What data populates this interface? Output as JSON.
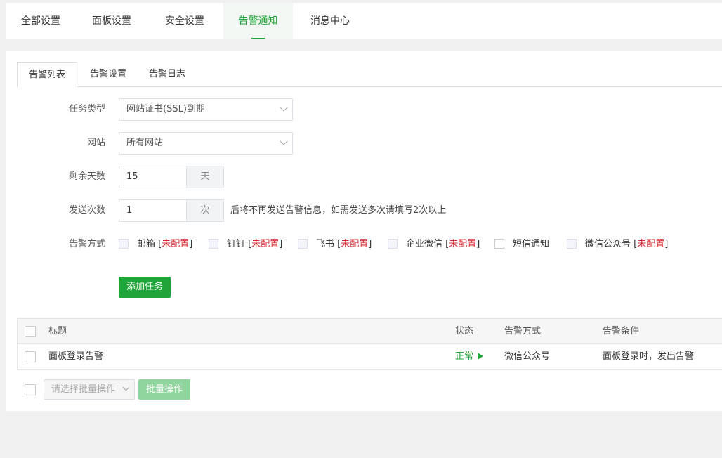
{
  "topnav": {
    "tabs": [
      {
        "label": "全部设置"
      },
      {
        "label": "面板设置"
      },
      {
        "label": "安全设置"
      },
      {
        "label": "告警通知"
      },
      {
        "label": "消息中心"
      }
    ],
    "active": "告警通知"
  },
  "subtabs": {
    "items": [
      {
        "label": "告警列表"
      },
      {
        "label": "告警设置"
      },
      {
        "label": "告警日志"
      }
    ],
    "active": "告警列表"
  },
  "form": {
    "task_type": {
      "label": "任务类型",
      "value": "网站证书(SSL)到期"
    },
    "site": {
      "label": "网站",
      "value": "所有网站"
    },
    "days": {
      "label": "剩余天数",
      "value": "15",
      "unit": "天"
    },
    "send_count": {
      "label": "发送次数",
      "value": "1",
      "unit": "次",
      "hint": "后将不再发送告警信息，如需发送多次请填写2次以上"
    },
    "methods": {
      "label": "告警方式",
      "items": [
        {
          "name": "邮箱",
          "status": "未配置"
        },
        {
          "name": "钉钉",
          "status": "未配置"
        },
        {
          "name": "飞书",
          "status": "未配置"
        },
        {
          "name": "企业微信",
          "status": "未配置"
        },
        {
          "name": "短信通知",
          "status": ""
        },
        {
          "name": "微信公众号",
          "status": "未配置"
        }
      ]
    },
    "add_button": "添加任务"
  },
  "table": {
    "headers": [
      "标题",
      "状态",
      "告警方式",
      "告警条件"
    ],
    "rows": [
      {
        "title": "面板登录告警",
        "status": "正常",
        "method": "微信公众号",
        "condition": "面板登录时，发出告警"
      }
    ]
  },
  "batch": {
    "placeholder": "请选择批量操作",
    "button": "批量操作"
  },
  "colors": {
    "accent": "#20a53a",
    "warning": "#d9232c"
  }
}
